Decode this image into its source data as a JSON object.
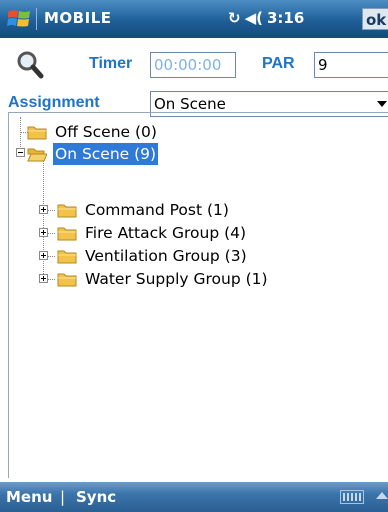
{
  "titlebar": {
    "title": "MOBILE",
    "connectivity_icon": "sync-arrows-icon",
    "volume_icon": "speaker-icon",
    "time": "3:16",
    "ok_label": "ok"
  },
  "form": {
    "search_icon": "magnifier-icon",
    "timer_label": "Timer",
    "timer_value": "00:00:00",
    "par_label": "PAR",
    "par_value": "9",
    "assignment_label": "Assignment",
    "assignment_value": "On Scene"
  },
  "tree": {
    "items": [
      {
        "label": "Off Scene (0)",
        "level": 0,
        "expander": "none",
        "selected": false
      },
      {
        "label": "On Scene (9)",
        "level": 0,
        "expander": "minus",
        "selected": true
      },
      {
        "label": "Command Post (1)",
        "level": 1,
        "expander": "plus",
        "selected": false
      },
      {
        "label": "Fire Attack Group (4)",
        "level": 1,
        "expander": "plus",
        "selected": false
      },
      {
        "label": "Ventilation Group (3)",
        "level": 1,
        "expander": "plus",
        "selected": false
      },
      {
        "label": "Water Supply Group (1)",
        "level": 1,
        "expander": "plus",
        "selected": false
      }
    ]
  },
  "menubar": {
    "left_label": "Menu",
    "separator": "|",
    "right_label": "Sync",
    "keyboard_icon": "keyboard-icon",
    "up_icon": "up-arrow-icon"
  },
  "colors": {
    "accent": "#1e74c6",
    "titlebar": "#1f5e97",
    "selection": "#2f7ad6",
    "folder": "#f2c24a"
  }
}
